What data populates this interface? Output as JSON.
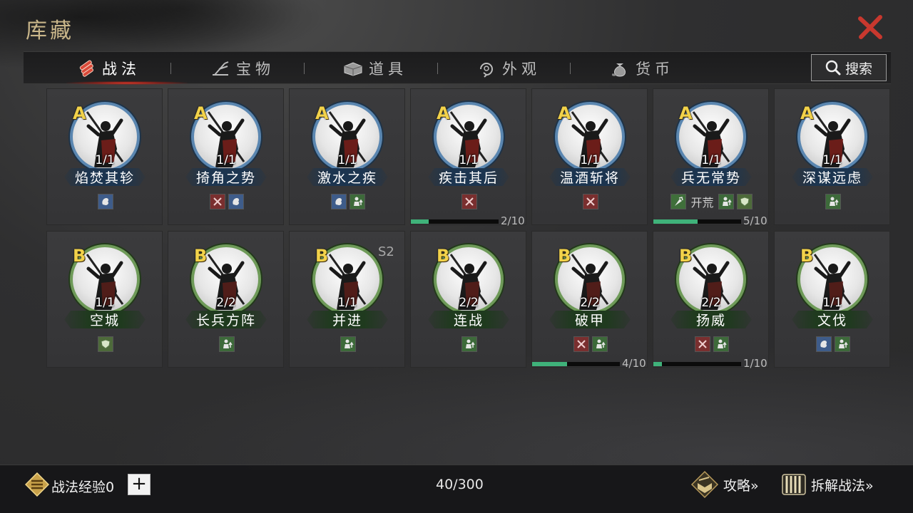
{
  "header": {
    "title": "库藏"
  },
  "tabs": [
    {
      "label": "战法",
      "icon": "scroll-bundle-icon",
      "active": true
    },
    {
      "label": "宝物",
      "icon": "crossbow-icon",
      "active": false
    },
    {
      "label": "道具",
      "icon": "chest-icon",
      "active": false
    },
    {
      "label": "外观",
      "icon": "swirl-icon",
      "active": false
    },
    {
      "label": "货币",
      "icon": "money-bag-icon",
      "active": false
    }
  ],
  "search": {
    "label": "搜索"
  },
  "colors": {
    "gradeA": "#5a86b0",
    "gradeB": "#6e9a58",
    "gradeText": "#f2d24a",
    "progress": "#3fb27a",
    "closeRed": "#c8382e"
  },
  "skills": [
    {
      "grade": "A",
      "count": "1/1",
      "name": "焰焚其轸",
      "tags": [
        "ctrl"
      ],
      "tag_text": "",
      "season": "",
      "progress": null
    },
    {
      "grade": "A",
      "count": "1/1",
      "name": "掎角之势",
      "tags": [
        "attack",
        "ctrl"
      ],
      "tag_text": "",
      "season": "",
      "progress": null
    },
    {
      "grade": "A",
      "count": "1/1",
      "name": "激水之疾",
      "tags": [
        "ctrl",
        "assist"
      ],
      "tag_text": "",
      "season": "",
      "progress": null
    },
    {
      "grade": "A",
      "count": "1/1",
      "name": "疾击其后",
      "tags": [
        "attack"
      ],
      "tag_text": "",
      "season": "",
      "progress": {
        "text": "2/10",
        "value": 0.2
      }
    },
    {
      "grade": "A",
      "count": "1/1",
      "name": "温酒斩将",
      "tags": [
        "attack"
      ],
      "tag_text": "",
      "season": "",
      "progress": null
    },
    {
      "grade": "A",
      "count": "1/1",
      "name": "兵无常势",
      "tags": [
        "cmd"
      ],
      "tag_text": "开荒",
      "tags_after": [
        "assist",
        "defend"
      ],
      "season": "",
      "progress": {
        "text": "5/10",
        "value": 0.5
      }
    },
    {
      "grade": "A",
      "count": "1/1",
      "name": "深谋远虑",
      "tags": [
        "assist"
      ],
      "tag_text": "",
      "season": "",
      "progress": null
    },
    {
      "grade": "B",
      "count": "1/1",
      "name": "空城",
      "tags": [
        "defend"
      ],
      "tag_text": "",
      "season": "",
      "progress": null
    },
    {
      "grade": "B",
      "count": "2/2",
      "name": "长兵方阵",
      "tags": [
        "assist"
      ],
      "tag_text": "",
      "season": "",
      "progress": null
    },
    {
      "grade": "B",
      "count": "1/1",
      "name": "并进",
      "tags": [
        "assist"
      ],
      "tag_text": "",
      "season": "S2",
      "progress": null
    },
    {
      "grade": "B",
      "count": "2/2",
      "name": "连战",
      "tags": [
        "assist"
      ],
      "tag_text": "",
      "season": "",
      "progress": null
    },
    {
      "grade": "B",
      "count": "2/2",
      "name": "破甲",
      "tags": [
        "attack",
        "assist"
      ],
      "tag_text": "",
      "season": "",
      "progress": {
        "text": "4/10",
        "value": 0.4
      }
    },
    {
      "grade": "B",
      "count": "2/2",
      "name": "扬威",
      "tags": [
        "attack",
        "assist"
      ],
      "tag_text": "",
      "season": "",
      "progress": {
        "text": "1/10",
        "value": 0.1
      }
    },
    {
      "grade": "B",
      "count": "1/1",
      "name": "文伐",
      "tags": [
        "ctrl",
        "assist"
      ],
      "tag_text": "",
      "season": "",
      "progress": null
    }
  ],
  "footer": {
    "exp_label": "战法经验",
    "exp_value": "0",
    "add_label": "+",
    "capacity": "40/300",
    "guide_label": "攻略»",
    "dismantle_label": "拆解战法»"
  }
}
